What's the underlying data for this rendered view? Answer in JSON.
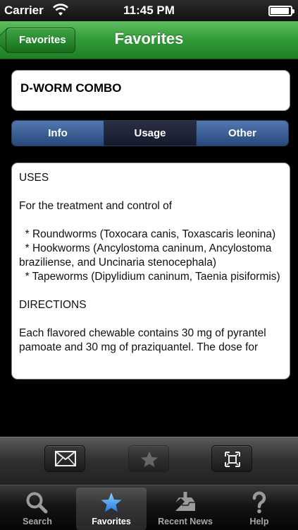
{
  "status_bar": {
    "carrier": "Carrier",
    "time": "11:45 PM"
  },
  "nav": {
    "back_label": "Favorites",
    "title": "Favorites"
  },
  "product": {
    "name": "D-WORM COMBO"
  },
  "segments": [
    {
      "label": "Info",
      "selected": false
    },
    {
      "label": "Usage",
      "selected": true
    },
    {
      "label": "Other",
      "selected": false
    }
  ],
  "content": {
    "text": "USES\n\nFor the treatment and control of\n\n  * Roundworms (Toxocara canis, Toxascaris leonina)\n  * Hookworms (Ancylostoma caninum, Ancylostoma braziliense, and Uncinaria stenocephala)\n  * Tapeworms (Dipylidium caninum, Taenia pisiformis)\n\nDIRECTIONS\n\nEach flavored chewable contains 30 mg of pyrantel pamoate and 30 mg of praziquantel. The dose for"
  },
  "toolbar": {
    "buttons": [
      {
        "icon": "envelope-icon",
        "enabled": true
      },
      {
        "icon": "star-icon",
        "enabled": false
      },
      {
        "icon": "fullscreen-icon",
        "enabled": true
      }
    ]
  },
  "tab_bar": {
    "tabs": [
      {
        "label": "Search",
        "icon": "search-icon",
        "selected": false
      },
      {
        "label": "Favorites",
        "icon": "star-icon",
        "selected": true
      },
      {
        "label": "Recent News",
        "icon": "inbox-icon",
        "selected": false
      },
      {
        "label": "Help",
        "icon": "help-icon",
        "selected": false
      }
    ]
  },
  "colors": {
    "nav_green": "#2f9a35",
    "segment_blue": "#3a5f96",
    "tab_selected_blue": "#4aa3f0"
  }
}
